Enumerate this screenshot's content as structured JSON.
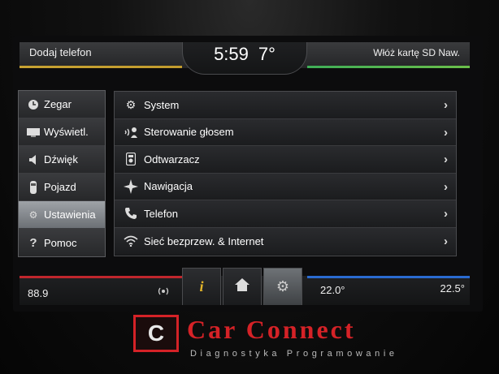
{
  "status": {
    "left": "Dodaj telefon",
    "time": "5:59",
    "temperature": "7°",
    "right": "Włóż kartę SD Naw."
  },
  "left_menu": [
    {
      "label": "Zegar",
      "icon": "clock-icon",
      "active": false
    },
    {
      "label": "Wyświetl.",
      "icon": "display-icon",
      "active": false
    },
    {
      "label": "Dźwięk",
      "icon": "speaker-icon",
      "active": false
    },
    {
      "label": "Pojazd",
      "icon": "car-icon",
      "active": false
    },
    {
      "label": "Ustawienia",
      "icon": "gear-icon",
      "active": true
    },
    {
      "label": "Pomoc",
      "icon": "question-icon",
      "active": false
    }
  ],
  "settings_list": [
    {
      "label": "System",
      "icon": "gear-icon"
    },
    {
      "label": "Sterowanie głosem",
      "icon": "voice-icon"
    },
    {
      "label": "Odtwarzacz",
      "icon": "media-player-icon"
    },
    {
      "label": "Nawigacja",
      "icon": "compass-icon"
    },
    {
      "label": "Telefon",
      "icon": "phone-icon"
    },
    {
      "label": "Sieć bezprzew. & Internet",
      "icon": "wifi-icon"
    }
  ],
  "bottom": {
    "radio_freq": "88.9",
    "temp_left_zone": "22.0°",
    "temp_right_zone": "22.5°"
  },
  "watermark": {
    "logo_letter": "C",
    "title": "Car Connect",
    "subtitle": "Diagnostyka Programowanie"
  },
  "colors": {
    "accent_yellow": "#c7a232",
    "accent_green": "#3fae57",
    "accent_red": "#c0262c",
    "accent_blue": "#2a6bd1",
    "brand_red": "#d52227"
  }
}
